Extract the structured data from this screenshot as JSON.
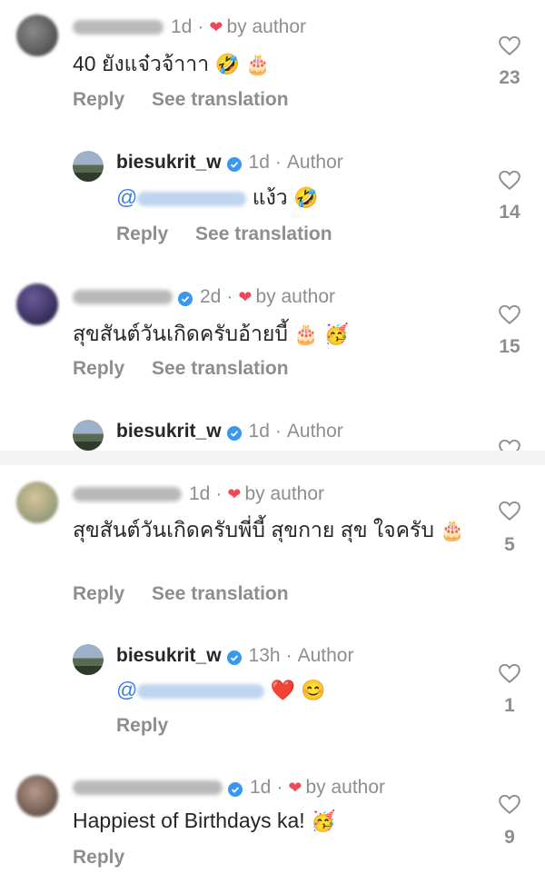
{
  "comments": [
    {
      "time": "1d",
      "badge": "by author",
      "text": "40 ยังแจ๋วจ้าาา",
      "emojis": "🤣 🎂",
      "reply": "Reply",
      "translate": "See translation",
      "likes": "23"
    },
    {
      "username": "biesukrit_w",
      "time": "1d",
      "role": "Author",
      "text_suffix": "แง้ว",
      "emojis": "🤣",
      "reply": "Reply",
      "translate": "See translation",
      "likes": "14"
    },
    {
      "time": "2d",
      "badge": "by author",
      "text": "สุขสันต์วันเกิดครับอ้ายบี้",
      "emojis": "🎂 🥳",
      "reply": "Reply",
      "translate": "See translation",
      "likes": "15"
    },
    {
      "username": "biesukrit_w",
      "time": "1d",
      "role": "Author"
    },
    {
      "time": "1d",
      "badge": "by author",
      "text": "สุขสันต์วันเกิดครับพี่บี้ สุขกาย สุข ใจครับ",
      "emojis": "🎂",
      "reply": "Reply",
      "translate": "See translation",
      "likes": "5"
    },
    {
      "username": "biesukrit_w",
      "time": "13h",
      "role": "Author",
      "emojis": "❤️ 😊",
      "reply": "Reply",
      "likes": "1"
    },
    {
      "time": "1d",
      "badge": "by author",
      "text": "Happiest of Birthdays ka!",
      "emojis": "🥳",
      "reply": "Reply",
      "likes": "9"
    }
  ],
  "colors": {
    "text": "#262626",
    "muted": "#8e8e8e",
    "heart": "#ed4956",
    "verified": "#3897f0"
  }
}
